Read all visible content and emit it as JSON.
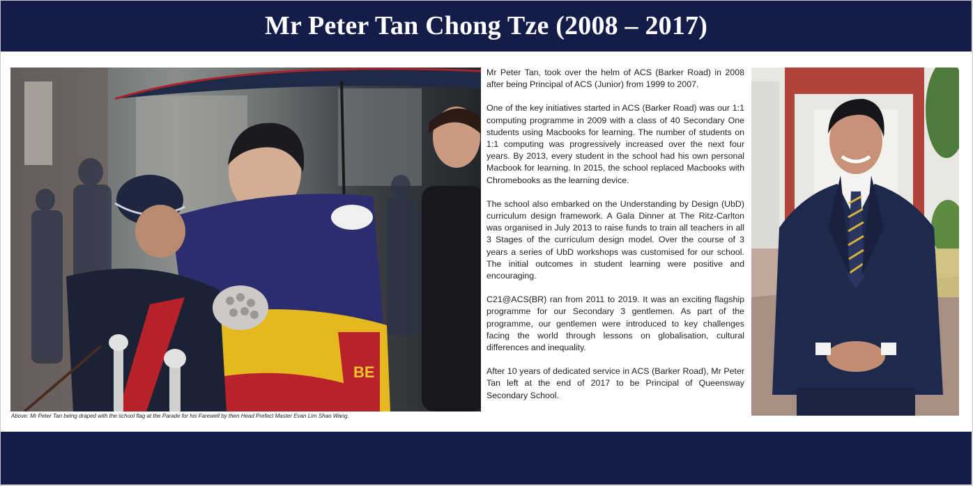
{
  "page": {
    "title": "Mr Peter Tan Chong Tze (2008 – 2017)"
  },
  "photo_left": {
    "caption": "Above: Mr Peter Tan being draped with the school flag at the Parade for his Farewell by then Head Prefect Master Evan Lim Shao Wang.",
    "flag_text": "BE"
  },
  "article": {
    "paragraphs": [
      "Mr Peter Tan, took over the helm of ACS (Barker Road) in 2008 after being Principal of ACS (Junior) from 1999 to 2007.",
      "One of the key initiatives started in ACS (Barker Road) was our 1:1 computing programme in 2009 with a class of 40 Secondary One students using Macbooks for learning. The number of students on 1:1 computing was progressively increased over the next four years. By 2013, every student in the school had his own personal Macbook for learning.  In 2015, the school replaced Macbooks with Chromebooks as the learning device.",
      "The school also embarked on the Understanding by Design (UbD) curriculum design framework. A Gala Dinner at The Ritz-Carlton was organised in July 2013 to raise funds to train all teachers in all 3 Stages of the curriculum design model. Over the course of 3 years a series of UbD workshops was customised for our school. The initial outcomes in student learning were positive and encouraging.",
      "C21@ACS(BR) ran from 2011 to 2019. It was an exciting flagship programme for our Secondary 3 gentlemen. As part of the programme, our gentlemen were introduced to key challenges facing the world through lessons on globalisation, cultural differences and inequality.",
      "After 10 years of dedicated service in ACS (Barker Road), Mr Peter Tan left at the end of 2017 to be Principal of Queensway Secondary School."
    ]
  },
  "colors": {
    "banner": "#141c4a",
    "flag_blue": "#2c2d6e",
    "flag_yellow": "#e6b81f",
    "flag_red": "#b8232b"
  }
}
